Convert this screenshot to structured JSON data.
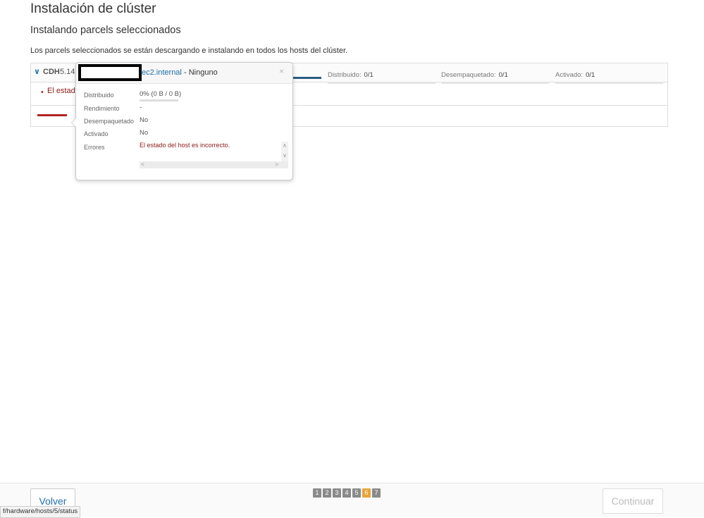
{
  "header": {
    "title": "Instalación de clúster",
    "subtitle": "Instalando parcels seleccionados",
    "description": "Los parcels seleccionados se están descargando e instalando en todos los hosts del clúster."
  },
  "parcel": {
    "name": "CDH",
    "version": "5.14.",
    "progress": [
      {
        "label": "Distribuido:",
        "value": "0/1"
      },
      {
        "label": "Desempaquetado:",
        "value": "0/1"
      },
      {
        "label": "Activado:",
        "value": "0/1"
      }
    ],
    "error_partial": "El estado"
  },
  "popover": {
    "host": "ec2.internal",
    "status": "- Ninguno",
    "close": "×",
    "rows": [
      {
        "label": "Distribuido",
        "value": "0% (0 B / 0 B)"
      },
      {
        "label": "Rendimiento",
        "value": "-"
      },
      {
        "label": "Desempaquetado",
        "value": "No"
      },
      {
        "label": "Activado",
        "value": "No"
      },
      {
        "label": "Errores",
        "value": "El estado del host es incorrecto."
      }
    ],
    "distributed_fraction": 0
  },
  "footer": {
    "back_label": "Volver",
    "continue_label": "Continuar",
    "steps": [
      "1",
      "2",
      "3",
      "4",
      "5",
      "6",
      "7"
    ],
    "current_step": "6"
  },
  "status_bar": {
    "url": "f/hardware/hosts/5/status"
  },
  "colors": {
    "link": "#1f6fa8",
    "error": "#8b1a1a",
    "current_step": "#e8a33a"
  }
}
